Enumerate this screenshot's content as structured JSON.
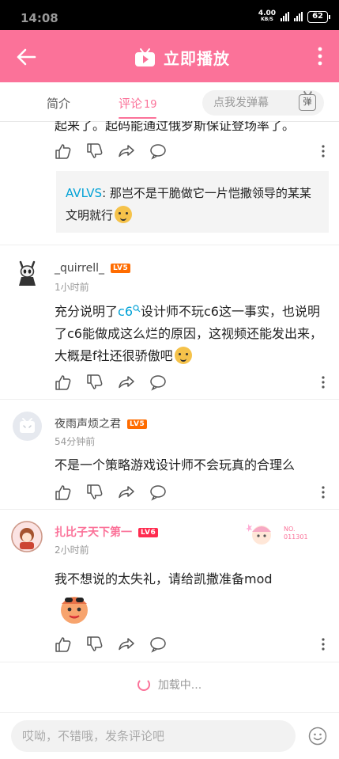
{
  "status": {
    "time": "14:08",
    "netspeed": "4.00",
    "netspeed_unit": "KB/S",
    "battery": "62"
  },
  "topbar": {
    "play_label": "立即播放"
  },
  "tabs": {
    "intro": "简介",
    "comments": "评论",
    "comments_count": "19",
    "danmaku_placeholder": "点我发弹幕",
    "danmaku_button": "弹"
  },
  "cut_comment": {
    "text": "起来了。起码能通过俄罗斯保证登场率了。"
  },
  "reply": {
    "user": "AVLVS",
    "text": ": 那岂不是干脆做它一片恺撒领导的某某文明就行"
  },
  "comments": [
    {
      "user": "_quirrell_",
      "level": "LV5",
      "time": "1小时前",
      "text_before": "充分说明了",
      "mention": "c6",
      "text_after": "设计师不玩c6这一事实，也说明了c6能做成这么烂的原因，这视频还能发出来，大概是f社还很骄傲吧"
    },
    {
      "user": "夜雨声烦之君",
      "level": "LV5",
      "time": "54分钟前",
      "text": "不是一个策略游戏设计师不会玩真的合理么"
    },
    {
      "user": "扎比子天下第一",
      "level": "LV6",
      "time": "2小时前",
      "text": "我不想说的太失礼，请给凯撒准备mod",
      "badge_no": "NO.",
      "badge_num": "011301"
    }
  ],
  "loading": {
    "label": "加载中..."
  },
  "bottom": {
    "placeholder": "哎呦，不错哦，发条评论吧"
  },
  "colors": {
    "accent": "#fb7299",
    "link": "#00a1d6",
    "level": "#ff6c00"
  }
}
